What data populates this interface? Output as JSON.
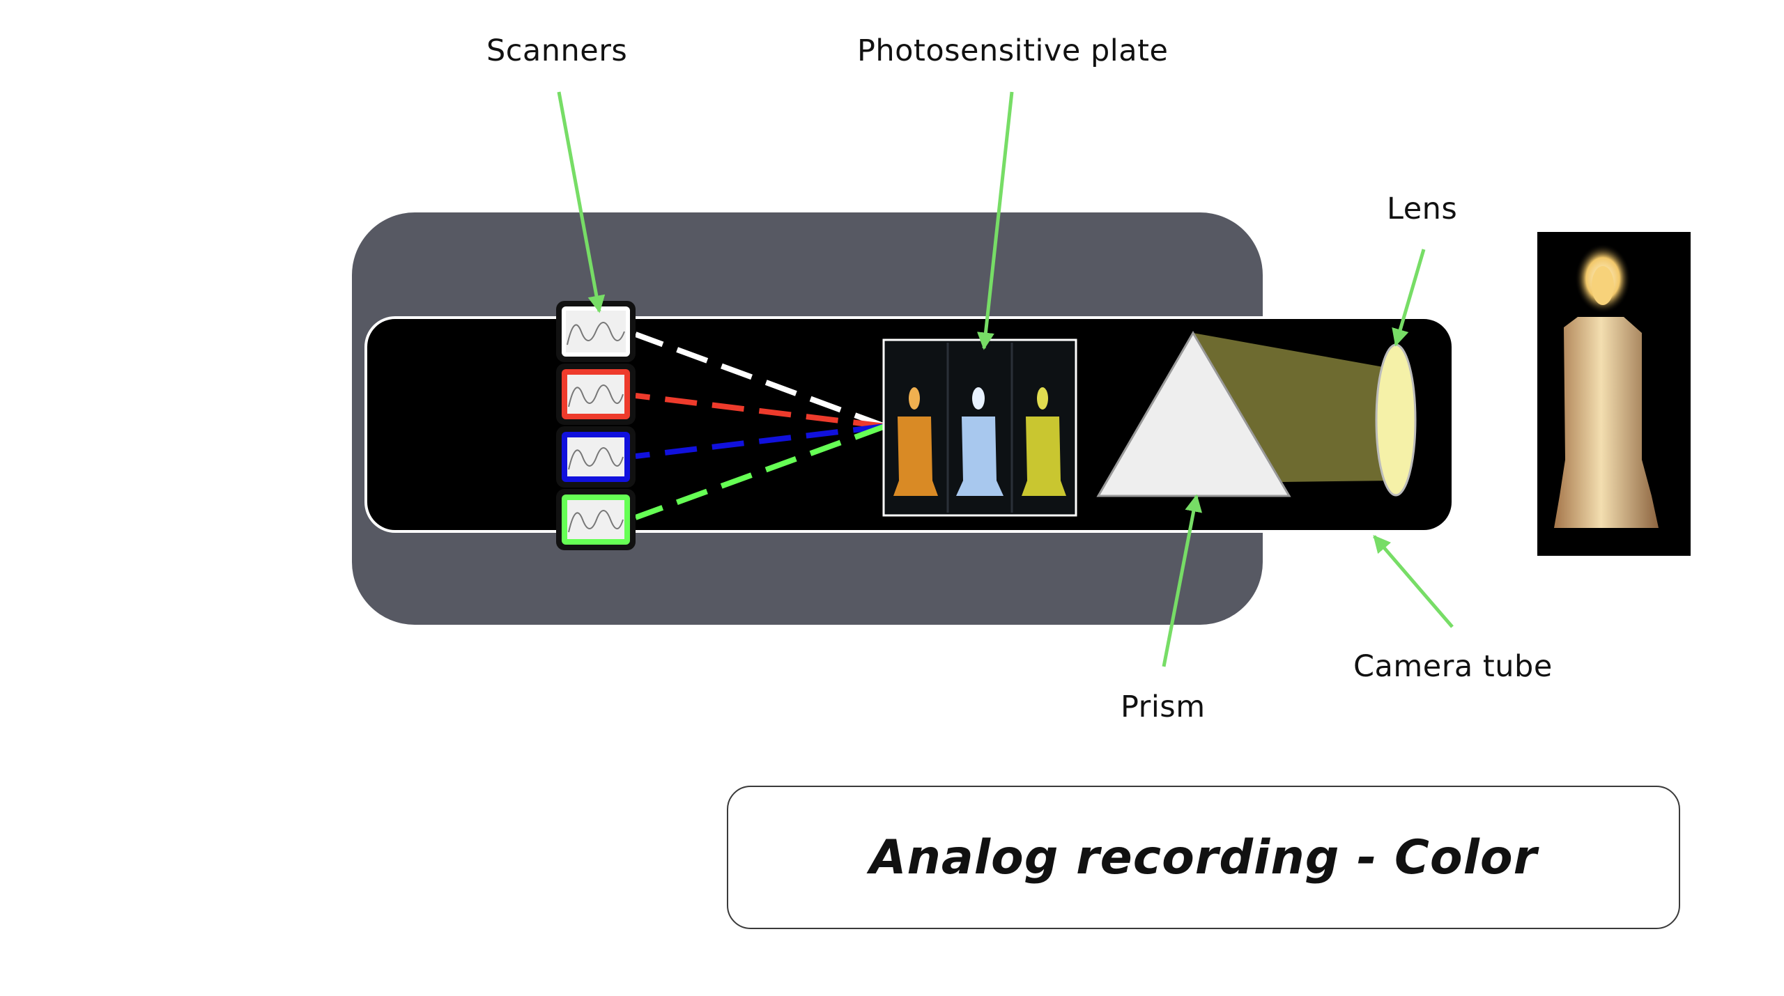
{
  "labels": {
    "scanners": "Scanners",
    "photosensitive_plate": "Photosensitive plate",
    "lens": "Lens",
    "prism": "Prism",
    "camera_tube": "Camera tube"
  },
  "title": "Analog recording - Color",
  "colors": {
    "housing": "#575963",
    "tube": "#000000",
    "arrow": "#77dd66",
    "scanner_white": "#ffffff",
    "scanner_red": "#ee3b2c",
    "scanner_blue": "#1111dd",
    "scanner_green": "#66ff55",
    "light_beam": "#6e6b30",
    "lens": "#f5f1a8",
    "prism": "#eeeeee",
    "candle_orange": "#d98a25",
    "candle_blue": "#a8c8ee",
    "candle_yellow": "#c9c630"
  }
}
